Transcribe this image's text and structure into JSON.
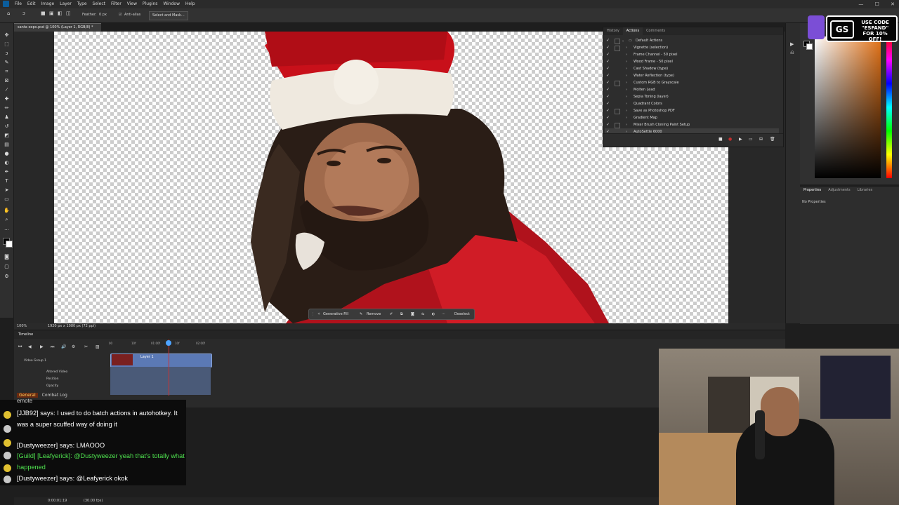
{
  "app": {
    "menu": [
      "File",
      "Edit",
      "Image",
      "Layer",
      "Type",
      "Select",
      "Filter",
      "View",
      "Plugins",
      "Window",
      "Help"
    ],
    "window_controls": [
      "—",
      "☐",
      "✕"
    ]
  },
  "options_bar": {
    "feather_label": "Feather:",
    "feather_value": "0 px",
    "antialias_label": "Anti-alias",
    "select_mask_label": "Select and Mask..."
  },
  "document": {
    "tab_title": "santa oops.psd @ 100% (Layer 1, RGB/8) *",
    "zoom": "100%",
    "size_info": "1920 px x 1080 px (72 ppi)"
  },
  "context_bar": {
    "generative_fill": "Generative Fill",
    "remove": "Remove",
    "deselect": "Deselect"
  },
  "actions_panel": {
    "tabs": [
      "History",
      "Actions",
      "Comments"
    ],
    "active_tab": "Actions",
    "set_name": "Default Actions",
    "items": [
      "Vignette (selection)",
      "Frame Channel - 50 pixel",
      "Wood Frame - 50 pixel",
      "Cast Shadow (type)",
      "Water Reflection (type)",
      "Custom RGB to Grayscale",
      "Molten Lead",
      "Sepia Toning (layer)",
      "Quadrant Colors",
      "Save as Photoshop PDF",
      "Gradient Map",
      "Mixer Brush Cloning Paint Setup",
      "AutoSettle 6000"
    ]
  },
  "properties_panel": {
    "tabs": [
      "Properties",
      "Adjustments",
      "Libraries"
    ],
    "content": "No Properties"
  },
  "promo": {
    "logo": "GS",
    "text": "USE CODE \"ESFAND\" FOR 10% OFF!"
  },
  "timeline": {
    "title": "Timeline",
    "ruler": [
      "00",
      "10f",
      "01:00f",
      "10f",
      "02:00f"
    ],
    "group_name": "Video Group 1",
    "layer_name": "Layer 1",
    "props": [
      "Altered Video",
      "Position",
      "Opacity"
    ],
    "timecode": "0:00:01:19",
    "fps": "(30.00 fps)"
  },
  "chat": {
    "tabs": [
      "General",
      "Combat Log"
    ],
    "partial_top": "emote",
    "messages": [
      {
        "text": "[JJB92] says:  I used to do batch actions in autohotkey. It was a super scuffed way of doing it",
        "guild": false
      },
      {
        "text": "[Dustyweezer] says:  LMAOOO",
        "guild": false
      },
      {
        "text": "[Guild] [Leafyerick]:  @Dustyweezer yeah that's totally what happened",
        "guild": true
      },
      {
        "text": "[Dustyweezer] says:  @Leafyerick okok",
        "guild": false
      }
    ]
  }
}
